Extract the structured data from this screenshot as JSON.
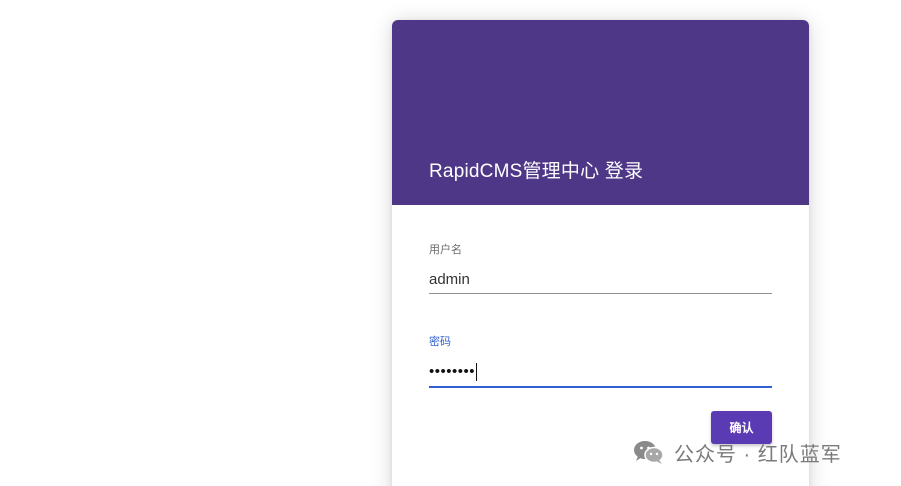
{
  "login": {
    "title": "RapidCMS管理中心 登录",
    "username": {
      "label": "用户名",
      "value": "admin"
    },
    "password": {
      "label": "密码",
      "masked_value": "••••••••"
    },
    "confirm_label": "确认"
  },
  "watermark": {
    "text": "公众号 · 红队蓝军",
    "icon": "wechat-icon"
  },
  "colors": {
    "header": "#4f3788",
    "button": "#5b3bb4",
    "focus": "#2f5fd0"
  }
}
